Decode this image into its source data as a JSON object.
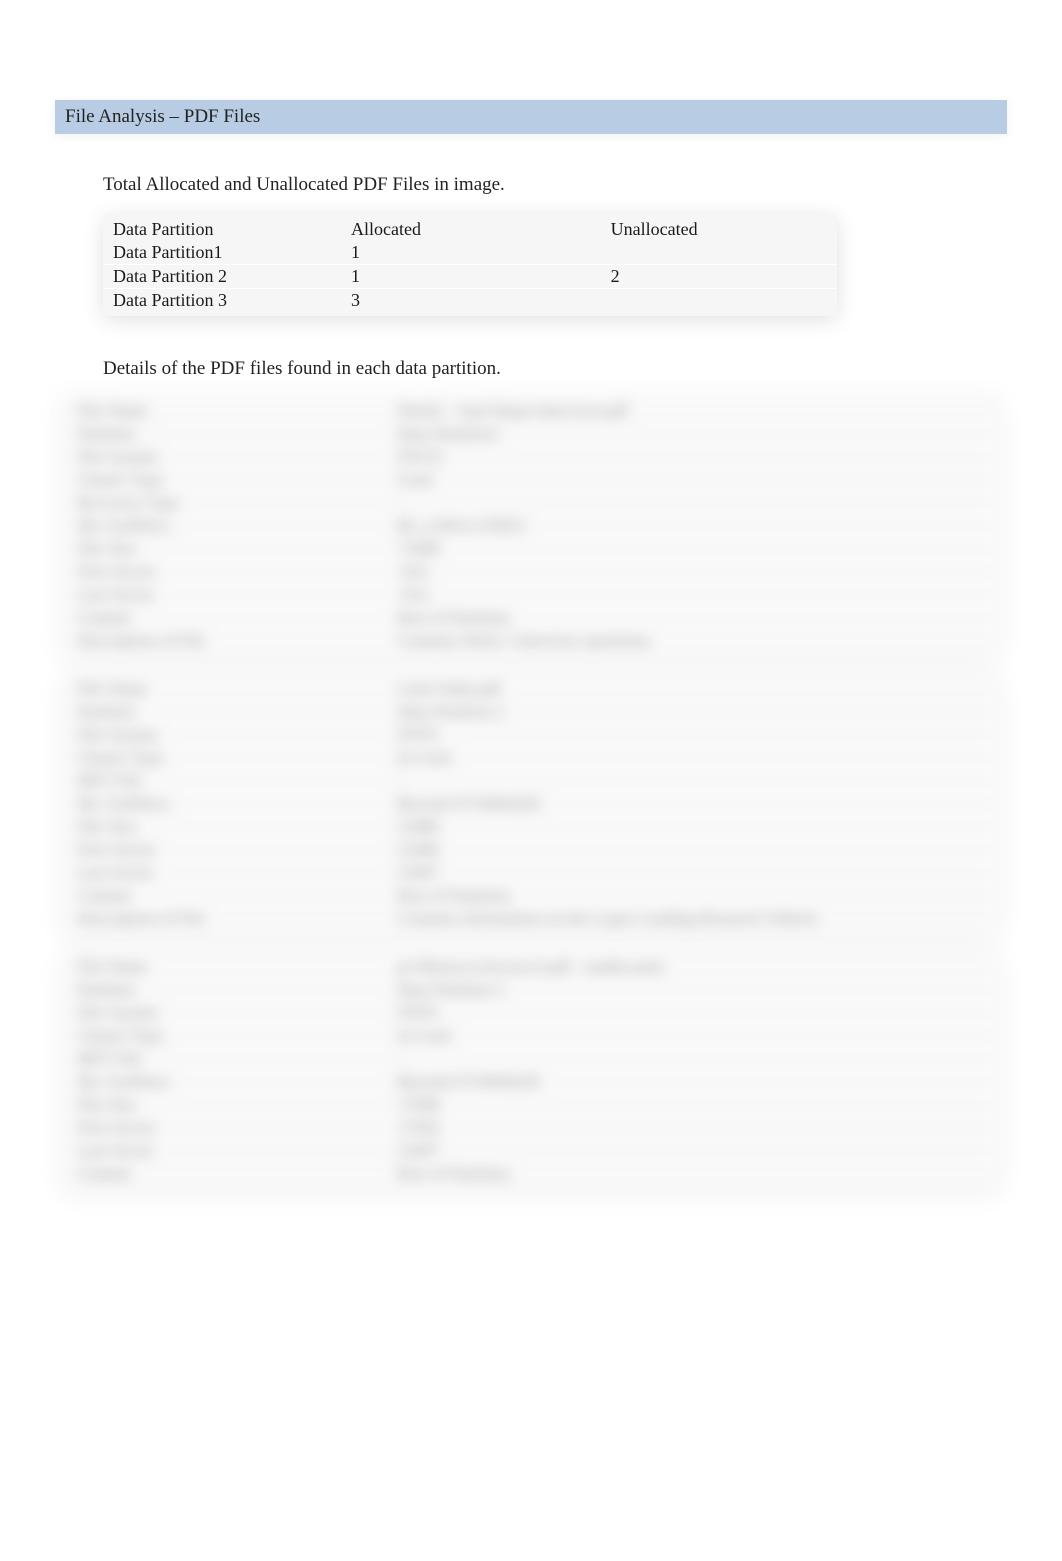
{
  "header": {
    "title": "File Analysis – PDF Files"
  },
  "summary": {
    "caption": "Total Allocated and Unallocated PDF Files in image.",
    "columns": {
      "c1": "Data Partition",
      "c2": "Allocated",
      "c3": "Unallocated"
    },
    "rows": [
      {
        "c1": "Data Partition1",
        "c2": "1",
        "c3": ""
      },
      {
        "c1": "Data Partition 2",
        "c2": "1",
        "c3": "2"
      },
      {
        "c1": "Data Partition 3",
        "c2": "3",
        "c3": ""
      }
    ]
  },
  "details": {
    "caption": "Details of the PDF files found in each data partition.",
    "blocks": [
      {
        "rows": [
          {
            "label": "File Name",
            "value": "Week2 - Saul Dejan Interview.pdf"
          },
          {
            "label": "Partition",
            "value": "Data Partition1"
          },
          {
            "label": "File System",
            "value": "FAT32"
          },
          {
            "label": "Cluster Type",
            "value": "Used"
          },
          {
            "label": "Recovery Type",
            "value": "-"
          },
          {
            "label": "Dir. Ext#Sect.",
            "value": "86_2,2814,135823"
          },
          {
            "label": "File Size",
            "value": "71688"
          },
          {
            "label": "First Sector",
            "value": "-NA-"
          },
          {
            "label": "Last Sector",
            "value": "-NA-"
          },
          {
            "label": "Content",
            "value": "Rest of Partition,"
          },
          {
            "label": "Description of File",
            "value": "Contains Week 2 interview questions."
          }
        ]
      },
      {
        "rows": [
          {
            "label": "File Name",
            "value": "Cash Order.pdf"
          },
          {
            "label": "Partition",
            "value": "Data Partition 2"
          },
          {
            "label": "File System",
            "value": "NTFS"
          },
          {
            "label": "Cluster Type",
            "value": "In Used"
          },
          {
            "label": "MFT File",
            "value": "-"
          },
          {
            "label": "Dir. Ext#Sect.",
            "value": "Beyond 4719404228"
          },
          {
            "label": "File Size",
            "value": "23486"
          },
          {
            "label": "First Sector",
            "value": "23496"
          },
          {
            "label": "Last Sector",
            "value": "23497"
          },
          {
            "label": "Content",
            "value": "Rest of Partition,"
          },
          {
            "label": "Description of File",
            "value": "Contains information on the Lopez Landing Research Vehicle."
          }
        ]
      },
      {
        "rows": [
          {
            "label": "File Name",
            "value": "pv/Monica's/invoice3.pdf - unallocated"
          },
          {
            "label": "Partition",
            "value": "Data Partition 2"
          },
          {
            "label": "File System",
            "value": "NTFS"
          },
          {
            "label": "Cluster Type",
            "value": "In Used"
          },
          {
            "label": "MFT File",
            "value": "-"
          },
          {
            "label": "Dir. Ext#Sect.",
            "value": "Beyond 4719404228"
          },
          {
            "label": "File Size",
            "value": "17948"
          },
          {
            "label": "First Sector",
            "value": "17956"
          },
          {
            "label": "Last Sector",
            "value": "23497"
          },
          {
            "label": "Content",
            "value": "Rest of Partition,"
          }
        ]
      }
    ]
  }
}
